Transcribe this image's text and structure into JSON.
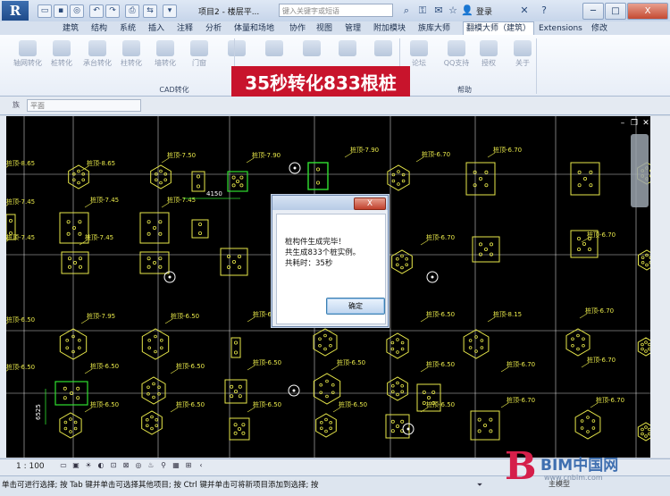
{
  "titlebar": {
    "doc_title": "项目2 - 楼层平...",
    "search_placeholder": "键入关键字或短语",
    "login": "登录",
    "minimize": "─",
    "maximize": "□",
    "close": "X",
    "help_icon": "?"
  },
  "ribbon": {
    "tabs": [
      "建筑",
      "结构",
      "系统",
      "插入",
      "注释",
      "分析",
      "体量和场地",
      "协作",
      "视图",
      "管理",
      "附加模块",
      "族库大师",
      "翻模大师（建筑）",
      "Extensions",
      "修改"
    ],
    "active_tab_index": 12,
    "buttons": [
      "轴网转化",
      "桩转化",
      "承台转化",
      "柱转化",
      "墙转化",
      "门窗",
      "",
      "",
      "",
      "",
      "",
      "论坛",
      "QQ支持",
      "授权",
      "关于"
    ],
    "group_cad": "CAD转化",
    "group_help": "帮助"
  },
  "banner": "35秒转化833根桩",
  "properties": {
    "label": "族",
    "select_value": "平面"
  },
  "canvas": {
    "pile_tags": [
      "桩顶-8.65",
      "桩顶-8.65",
      "桩顶-7.50",
      "桩顶-7.90",
      "桩顶-7.90",
      "桩顶-6.70",
      "桩顶-6.70",
      "桩顶-7.45",
      "桩顶-7.45",
      "桩顶-7.45",
      "桩顶-7.45",
      "桩顶-7.45",
      "桩顶-6.70",
      "桩顶-6.70",
      "桩顶-6.50",
      "桩顶-7.95",
      "桩顶-6.50",
      "桩顶-6.50",
      "桩顶-6.50",
      "桩顶-6.50",
      "桩顶-6.50",
      "桩顶-6.50",
      "桩顶-6.50",
      "桩顶-6.50",
      "桩顶-6.50",
      "桩顶-8.15",
      "桩顶-6.70",
      "桩顶-6.70",
      "桩顶-6.50",
      "桩顶-6.50",
      "桩顶-6.50",
      "桩顶-6.50",
      "桩顶-6.50",
      "桩顶-6.70",
      "桩顶-6.50",
      "桩顶-6.70",
      "桩顶-6.70"
    ],
    "dims": [
      "4150",
      "6525"
    ]
  },
  "dialog": {
    "close": "X",
    "line1": "桩构件生成完毕！",
    "line2": "共生成833个桩实例。",
    "line3": "共耗时：35秒",
    "ok": "确定"
  },
  "viewctrl": {
    "scale": "1 : 100"
  },
  "statusbar": {
    "text": "单击可进行选择; 按 Tab 键并单击可选择其他项目; 按 Ctrl 键并单击可将新项目添加到选择; 按",
    "model": "主模型"
  },
  "watermark": {
    "letter": "B",
    "name": "BIM中国网",
    "url": "www.cnbim.com"
  },
  "colors": {
    "banner_bg": "#c8142c",
    "canvas_bg": "#000000",
    "cad_line": "#e8e84a",
    "grid_line": "#ffffff",
    "dim_line": "#30e030"
  }
}
